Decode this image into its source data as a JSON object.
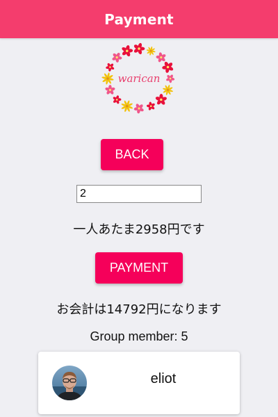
{
  "header": {
    "title": "Payment"
  },
  "logo": {
    "text": "warican",
    "colors": {
      "red": "#e8103a",
      "pink": "#f0568a",
      "yellow": "#f2c20d"
    }
  },
  "back_button": {
    "label": "BACK"
  },
  "count_input": {
    "value": "2"
  },
  "per_person_text": "一人あたま2958円です",
  "payment_button": {
    "label": "PAYMENT"
  },
  "total_text": "お会計は14792円になります",
  "group": {
    "label": "Group member: 5",
    "members": [
      {
        "name": "eliot",
        "avatar": "person-avatar-icon"
      }
    ]
  },
  "colors": {
    "header": "#f43d6d",
    "button": "#f5005a",
    "background": "#efeff3"
  }
}
